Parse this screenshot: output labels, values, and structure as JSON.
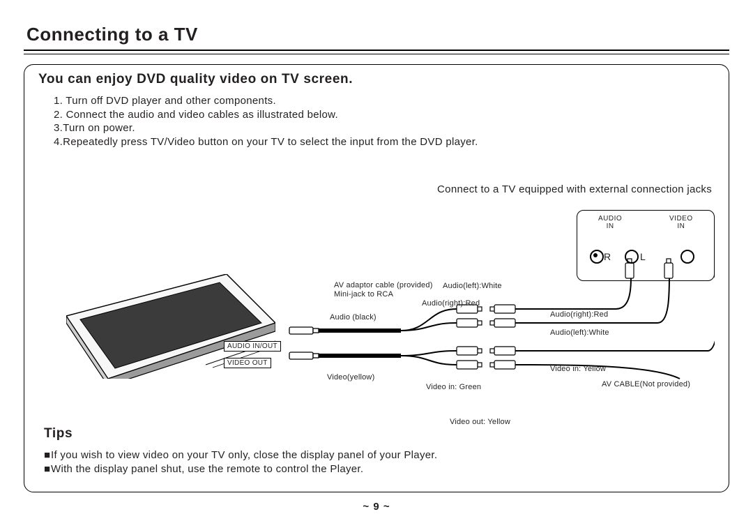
{
  "page_title": "Connecting to a TV",
  "intro_title": "You can enjoy DVD quality video on TV screen.",
  "steps": [
    "1. Turn off DVD player and other components.",
    "2. Connect the audio and video cables as illustrated below.",
    "3.Turn on power.",
    "4.Repeatedly press TV/Video button on your TV to select the input from the DVD player."
  ],
  "diagram": {
    "caption": "Connect to a TV equipped with external connection jacks",
    "tvbox": {
      "audio_hdr": "AUDIO\nIN",
      "video_hdr": "VIDEO\nIN",
      "R": "R",
      "L": "L"
    },
    "player_ports": {
      "audio": "AUDIO IN/OUT",
      "video": "VIDEO OUT"
    },
    "labels": {
      "adaptor1": "AV adaptor cable (provided)",
      "adaptor2": "Mini-jack to RCA",
      "audio_black": "Audio (black)",
      "video_yellow": "Video(yellow)",
      "aleft_white_1": "Audio(left):White",
      "aright_red_1": "Audio(right):Red",
      "video_in_green": "Video in: Green",
      "video_out_yellow": "Video out: Yellow",
      "aright_red_2": "Audio(right):Red",
      "aleft_white_2": "Audio(left):White",
      "video_in_yellow": "Video in: Yellow",
      "av_cable": "AV CABLE(Not provided)"
    }
  },
  "tips_title": "Tips",
  "tips": [
    "If you wish to view video on your TV only, close the display panel of your Player.",
    "With the display panel shut, use the remote to control the Player."
  ],
  "page_number": "~ 9 ~"
}
